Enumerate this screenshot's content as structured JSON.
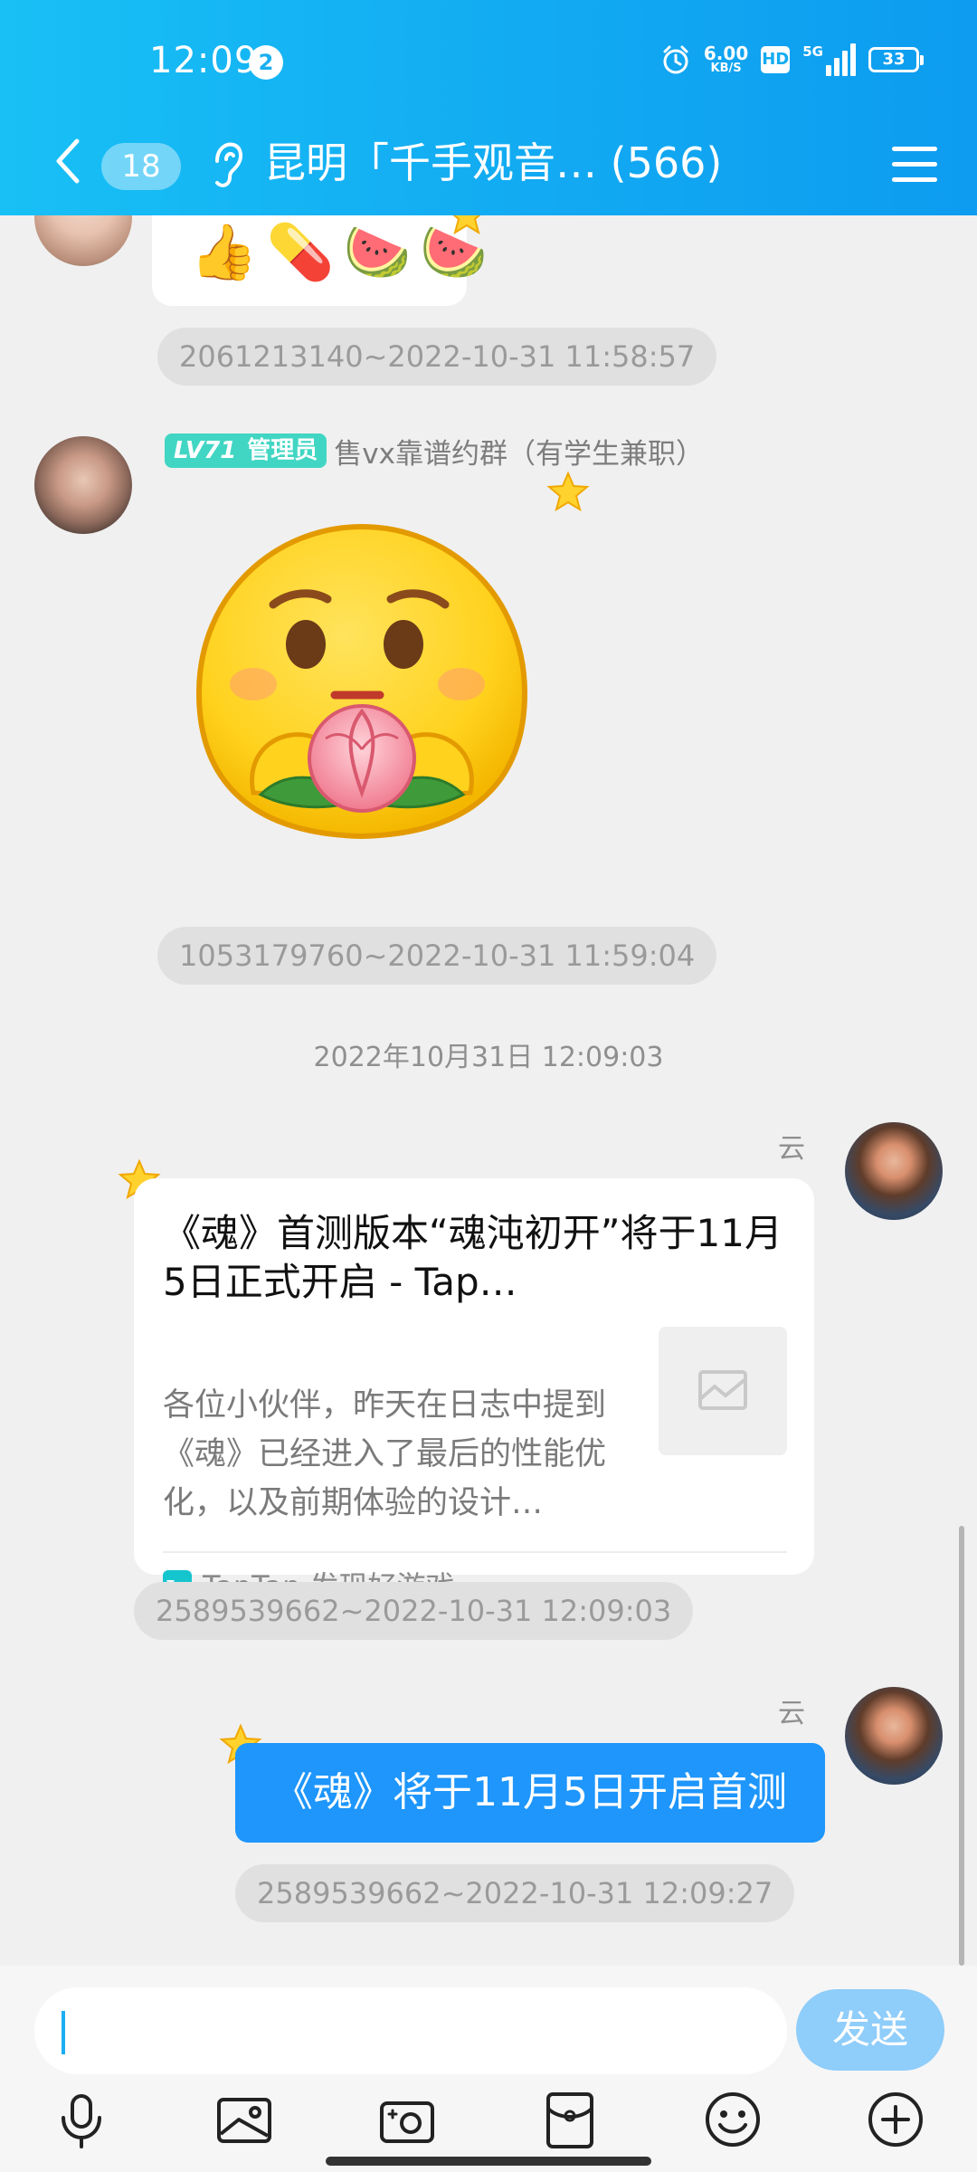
{
  "status_bar": {
    "time": "12:09",
    "notification_count": "2",
    "net_speed_value": "6.00",
    "net_speed_unit": "KB/S",
    "hd_label": "HD",
    "network_label": "5G",
    "battery": "33"
  },
  "header": {
    "unread_count": "18",
    "title": "昆明「千手观音…  (566)"
  },
  "messages": {
    "emoji_row": [
      "👍",
      "💊",
      "🍉",
      "🍉"
    ],
    "tag_1": "2061213140~2022-10-31 11:58:57",
    "sender_level": "LV71",
    "sender_role": "管理员",
    "sender_name": "售vx靠谱约群（有学生兼职）",
    "tag_2": "1053179760~2022-10-31 11:59:04",
    "date_divider": "2022年10月31日 12:09:03",
    "cloud_label_1": "云",
    "link_card": {
      "title": "《魂》首测版本“魂沌初开”将于11月5日正式开启 - Tap…",
      "description": "各位小伙伴，昨天在日志中提到《魂》已经进入了最后的性能优化，以及前期体验的设计…",
      "source_logo": "Tap",
      "source": "TapTap 发现好游戏"
    },
    "tag_3": "2589539662~2022-10-31 12:09:03",
    "cloud_label_2": "云",
    "blue_text": "《魂》将于11月5日开启首测",
    "tag_4": "2589539662~2022-10-31 12:09:27"
  },
  "input": {
    "send_label": "发送"
  },
  "colors": {
    "header": "#12aaf2",
    "bubble_blue": "#1e96fb",
    "send_button": "#8fcdfa",
    "level_badge": "#41d6c3"
  }
}
